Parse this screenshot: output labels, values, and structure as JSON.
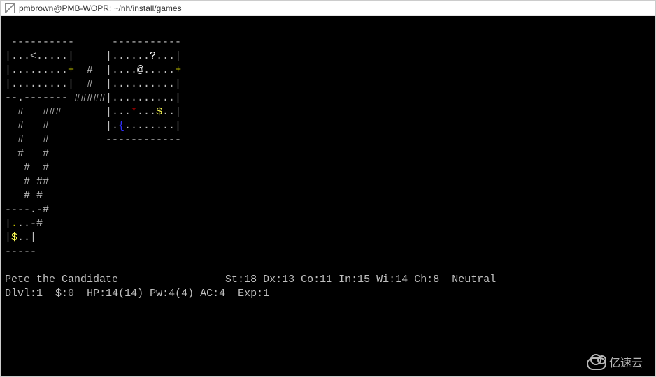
{
  "window": {
    "title": "pmbrown@PMB-WOPR: ~/nh/install/games"
  },
  "map": {
    "lines": [
      "|...<.....|     |......?...|",
      "|.........+  #  |....@.....+",
      "|.........|  #  |..........|",
      "--.------- #####|..........|",
      "  #   ###       |...*...$..|",
      "  #   #         |.{........|",
      "  #   #         ------------",
      "  #   #",
      "   #  #",
      "   # ##",
      "   # #",
      "----.-#",
      "|...-#",
      "|$..|",
      "-----"
    ],
    "row1_top": " ----------      -----------"
  },
  "status": {
    "name": "Pete the Candidate",
    "St": "18",
    "Dx": "13",
    "Co": "11",
    "In": "15",
    "Wi": "14",
    "Ch": "8",
    "align": "Neutral",
    "Dlvl": "1",
    "gold": "0",
    "HP": "14(14)",
    "Pw": "4(4)",
    "AC": "4",
    "Exp": "1"
  },
  "watermark": {
    "text": "亿速云"
  }
}
